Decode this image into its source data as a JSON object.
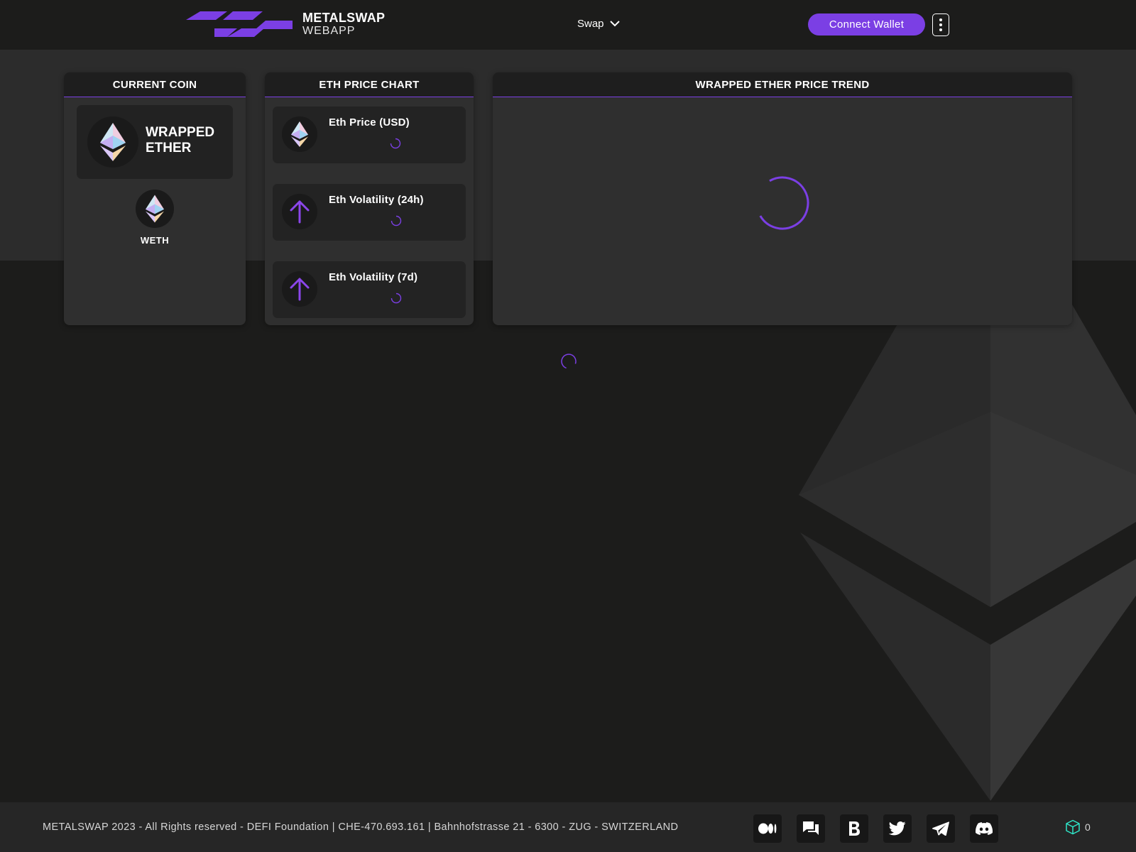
{
  "brand": {
    "name": "METALSWAP",
    "subtitle": "WEBAPP"
  },
  "nav": {
    "swap_label": "Swap"
  },
  "header": {
    "connect_label": "Connect Wallet"
  },
  "current_coin": {
    "heading": "CURRENT COIN",
    "name_line1": "WRAPPED",
    "name_line2": "ETHER",
    "symbol": "WETH"
  },
  "eth_chart": {
    "heading": "ETH PRICE CHART",
    "stats": [
      {
        "title": "Eth Price (USD)",
        "icon": "ethereum-icon"
      },
      {
        "title": "Eth Volatility (24h)",
        "icon": "arrow-up-icon"
      },
      {
        "title": "Eth Volatility (7d)",
        "icon": "arrow-up-icon"
      }
    ]
  },
  "trend": {
    "heading": "WRAPPED ETHER PRICE TREND"
  },
  "footer": {
    "text": "METALSWAP 2023 - All Rights reserved - DEFI Foundation | CHE-470.693.161 | Bahnhofstrasse 21 - 6300 - ZUG - SWITZERLAND",
    "socials": [
      "medium-icon",
      "forum-icon",
      "bitcointalk-icon",
      "twitter-icon",
      "telegram-icon",
      "discord-icon"
    ],
    "block_number": "0"
  },
  "colors": {
    "accent": "#7b3fe4",
    "block_icon": "#2ee6c8"
  }
}
